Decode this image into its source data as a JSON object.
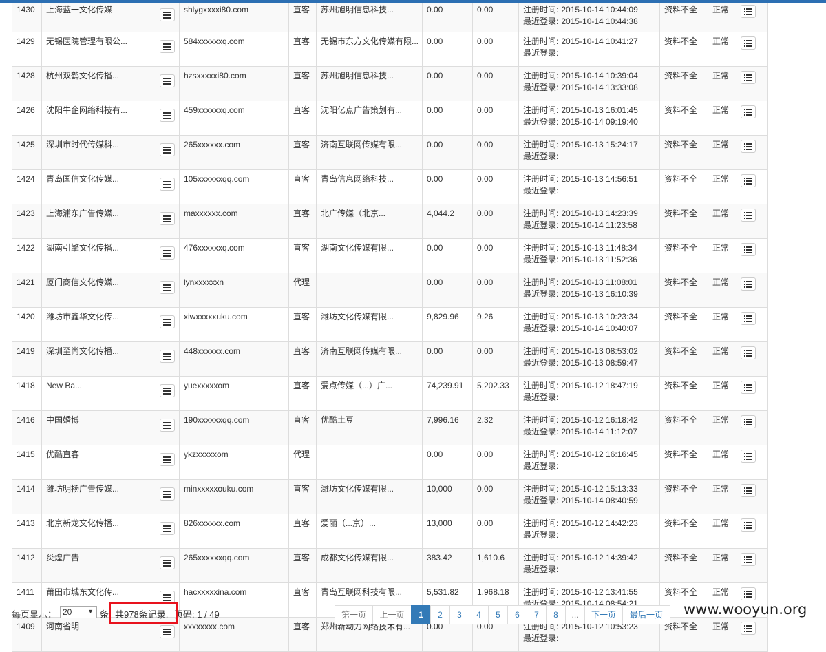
{
  "colors": {
    "accent": "#337ab7",
    "highlight_box": "#e8121d",
    "top_bar": "#2c6fb3"
  },
  "icons": {
    "row_action": "list-icon"
  },
  "rows": [
    {
      "id": "1430",
      "name": "上海蓝一文化传媒",
      "email": "shlygxxxxi80.com",
      "type": "直客",
      "company": "苏州旭明信息科技...",
      "balance": "0.00",
      "spend": "0.00",
      "reg_label": "注册时间:",
      "reg": "2015-10-14 10:44:09",
      "login_label": "最近登录:",
      "login": "2015-10-14 10:44:38",
      "profile": "资料不全",
      "status": "正常"
    },
    {
      "id": "1429",
      "name": "无锡医院管理有限公...",
      "email": "584xxxxxxq.com",
      "type": "直客",
      "company": "无锡市东方文化传媒有限...",
      "balance": "0.00",
      "spend": "0.00",
      "reg_label": "注册时间:",
      "reg": "2015-10-14 10:41:27",
      "login_label": "最近登录:",
      "login": "",
      "profile": "资料不全",
      "status": "正常"
    },
    {
      "id": "1428",
      "name": "杭州双鹤文化传播...",
      "email": "hzsxxxxxi80.com",
      "type": "直客",
      "company": "苏州旭明信息科技...",
      "balance": "0.00",
      "spend": "0.00",
      "reg_label": "注册时间:",
      "reg": "2015-10-14 10:39:04",
      "login_label": "最近登录:",
      "login": "2015-10-14 13:33:08",
      "profile": "资料不全",
      "status": "正常"
    },
    {
      "id": "1426",
      "name": "沈阳牛企网络科技有...",
      "email": "459xxxxxxq.com",
      "type": "直客",
      "company": "沈阳亿点广告策划有...",
      "balance": "0.00",
      "spend": "0.00",
      "reg_label": "注册时间:",
      "reg": "2015-10-13 16:01:45",
      "login_label": "最近登录:",
      "login": "2015-10-14 09:19:40",
      "profile": "资料不全",
      "status": "正常"
    },
    {
      "id": "1425",
      "name": "深圳市时代传媒科...",
      "email": "265xxxxxx.com",
      "type": "直客",
      "company": "济南互联网传媒有限...",
      "balance": "0.00",
      "spend": "0.00",
      "reg_label": "注册时间:",
      "reg": "2015-10-13 15:24:17",
      "login_label": "最近登录:",
      "login": "",
      "profile": "资料不全",
      "status": "正常"
    },
    {
      "id": "1424",
      "name": "青岛国信文化传媒...",
      "email": "105xxxxxxqq.com",
      "type": "直客",
      "company": "青岛信息网络科技...",
      "balance": "0.00",
      "spend": "0.00",
      "reg_label": "注册时间:",
      "reg": "2015-10-13 14:56:51",
      "login_label": "最近登录:",
      "login": "",
      "profile": "资料不全",
      "status": "正常"
    },
    {
      "id": "1423",
      "name": "上海浦东广告传媒...",
      "email": "maxxxxxx.com",
      "type": "直客",
      "company": "北广传媒（北京...",
      "balance": "4,044.2",
      "spend": "0.00",
      "reg_label": "注册时间:",
      "reg": "2015-10-13 14:23:39",
      "login_label": "最近登录:",
      "login": "2015-10-14 11:23:58",
      "profile": "资料不全",
      "status": "正常"
    },
    {
      "id": "1422",
      "name": "湖南引擎文化传播...",
      "email": "476xxxxxxq.com",
      "type": "直客",
      "company": "湖南文化传媒有限...",
      "balance": "0.00",
      "spend": "0.00",
      "reg_label": "注册时间:",
      "reg": "2015-10-13 11:48:34",
      "login_label": "最近登录:",
      "login": "2015-10-13 11:52:36",
      "profile": "资料不全",
      "status": "正常"
    },
    {
      "id": "1421",
      "name": "厦门商信文化传媒...",
      "email": "lynxxxxxxn",
      "type": "代理",
      "company": "",
      "balance": "0.00",
      "spend": "0.00",
      "reg_label": "注册时间:",
      "reg": "2015-10-13 11:08:01",
      "login_label": "最近登录:",
      "login": "2015-10-13 16:10:39",
      "profile": "资料不全",
      "status": "正常"
    },
    {
      "id": "1420",
      "name": "潍坊市鑫华文化传...",
      "email": "xiwxxxxxuku.com",
      "type": "直客",
      "company": "潍坊文化传媒有限...",
      "balance": "9,829.96",
      "spend": "9.26",
      "reg_label": "注册时间:",
      "reg": "2015-10-13 10:23:34",
      "login_label": "最近登录:",
      "login": "2015-10-14 10:40:07",
      "profile": "资料不全",
      "status": "正常"
    },
    {
      "id": "1419",
      "name": "深圳至尚文化传播...",
      "email": "448xxxxxx.com",
      "type": "直客",
      "company": "济南互联网传媒有限...",
      "balance": "0.00",
      "spend": "0.00",
      "reg_label": "注册时间:",
      "reg": "2015-10-13 08:53:02",
      "login_label": "最近登录:",
      "login": "2015-10-13 08:59:47",
      "profile": "资料不全",
      "status": "正常"
    },
    {
      "id": "1418",
      "name": "New Ba...",
      "email": "yuexxxxxom",
      "type": "直客",
      "company": "爱点传媒（...）广...",
      "balance": "74,239.91",
      "spend": "5,202.33",
      "reg_label": "注册时间:",
      "reg": "2015-10-12 18:47:19",
      "login_label": "最近登录:",
      "login": "",
      "profile": "资料不全",
      "status": "正常"
    },
    {
      "id": "1416",
      "name": "中国婚博",
      "email": "190xxxxxxqq.com",
      "type": "直客",
      "company": "优酷土豆",
      "balance": "7,996.16",
      "spend": "2.32",
      "reg_label": "注册时间:",
      "reg": "2015-10-12 16:18:42",
      "login_label": "最近登录:",
      "login": "2015-10-14 11:12:07",
      "profile": "资料不全",
      "status": "正常"
    },
    {
      "id": "1415",
      "name": "优酷直客",
      "email": "ykzxxxxxom",
      "type": "代理",
      "company": "",
      "balance": "0.00",
      "spend": "0.00",
      "reg_label": "注册时间:",
      "reg": "2015-10-12 16:16:45",
      "login_label": "最近登录:",
      "login": "",
      "profile": "资料不全",
      "status": "正常"
    },
    {
      "id": "1414",
      "name": "潍坊明扬广告传媒...",
      "email": "minxxxxxouku.com",
      "type": "直客",
      "company": "潍坊文化传媒有限...",
      "balance": "10,000",
      "spend": "0.00",
      "reg_label": "注册时间:",
      "reg": "2015-10-12 15:13:33",
      "login_label": "最近登录:",
      "login": "2015-10-14 08:40:59",
      "profile": "资料不全",
      "status": "正常"
    },
    {
      "id": "1413",
      "name": "北京新龙文化传播...",
      "email": "826xxxxxx.com",
      "type": "直客",
      "company": "爱丽（...京）...",
      "balance": "13,000",
      "spend": "0.00",
      "reg_label": "注册时间:",
      "reg": "2015-10-12 14:42:23",
      "login_label": "最近登录:",
      "login": "",
      "profile": "资料不全",
      "status": "正常"
    },
    {
      "id": "1412",
      "name": "炎煌广告",
      "email": "265xxxxxxqq.com",
      "type": "直客",
      "company": "成都文化传媒有限...",
      "balance": "383.42",
      "spend": "1,610.6",
      "reg_label": "注册时间:",
      "reg": "2015-10-12 14:39:42",
      "login_label": "最近登录:",
      "login": "",
      "profile": "资料不全",
      "status": "正常"
    },
    {
      "id": "1411",
      "name": "莆田市城东文化传...",
      "email": "hacxxxxxina.com",
      "type": "直客",
      "company": "青岛互联网科技有限...",
      "balance": "5,531.82",
      "spend": "1,968.18",
      "reg_label": "注册时间:",
      "reg": "2015-10-12 13:41:55",
      "login_label": "最近登录:",
      "login": "2015-10-14 08:54:21",
      "profile": "资料不全",
      "status": "正常"
    },
    {
      "id": "1409",
      "name": "河南省明",
      "email": "xxxxxxxx.com",
      "type": "直客",
      "company": "郑州新动力网络技术有...",
      "balance": "0.00",
      "spend": "0.00",
      "reg_label": "注册时间:",
      "reg": "2015-10-12 10:53:23",
      "login_label": "最近登录:",
      "login": "",
      "profile": "资料不全",
      "status": "正常"
    }
  ],
  "footer": {
    "pagesize_label": "每页显示：",
    "pagesize_value": "20",
    "pagesize_suffix": "条",
    "total_text": "共978条记录,",
    "page_text": "页码: 1 / 49",
    "pagination": {
      "first": "第一页",
      "prev": "上一页",
      "pages": [
        "1",
        "2",
        "3",
        "4",
        "5",
        "6",
        "7",
        "8",
        "..."
      ],
      "current": "1",
      "next": "下一页",
      "last": "最后一页"
    }
  },
  "watermark": "www.wooyun.org"
}
